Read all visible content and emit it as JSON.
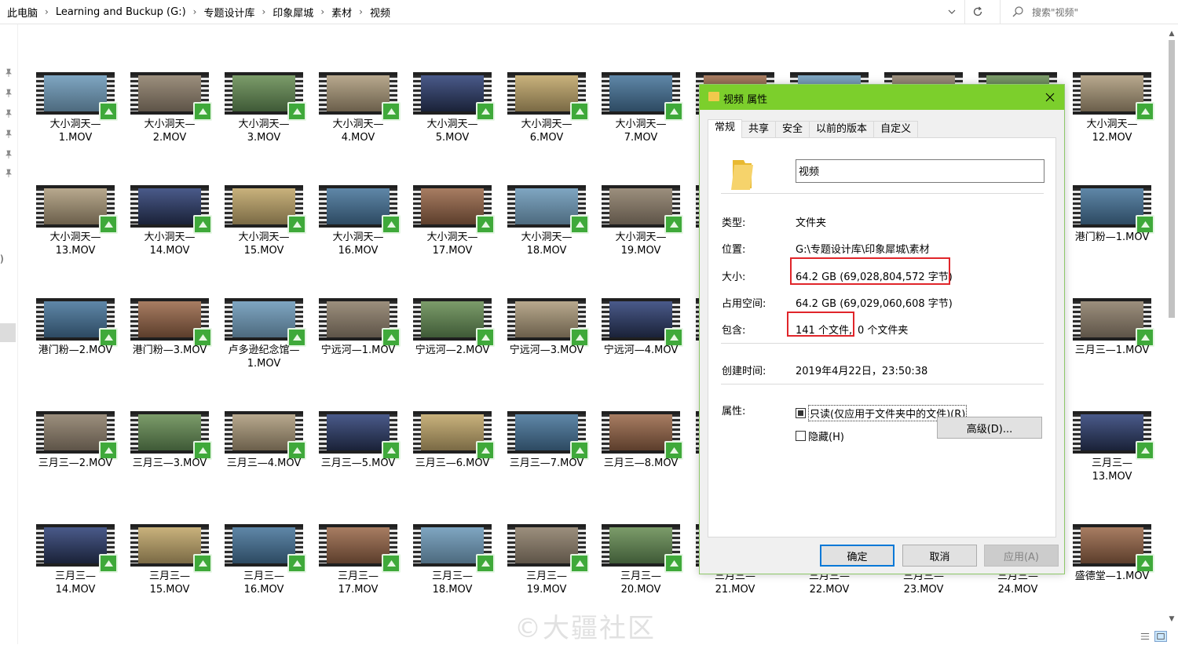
{
  "breadcrumb": {
    "items": [
      "此电脑",
      "Learning and Buckup (G:)",
      "专题设计库",
      "印象犀城",
      "素材",
      "视频"
    ]
  },
  "search": {
    "placeholder": "搜索\"视频\""
  },
  "watermark": "©大疆社区",
  "files": {
    "row1": [
      "大小洞天—\n1.MOV",
      "大小洞天—\n2.MOV",
      "大小洞天—\n3.MOV",
      "大小洞天—\n4.MOV",
      "大小洞天—\n5.MOV",
      "大小洞天—\n6.MOV",
      "大小洞天—\n7.MOV",
      "",
      "",
      "",
      "",
      "大小洞天—\n12.MOV"
    ],
    "row2": [
      "大小洞天—\n13.MOV",
      "大小洞天—\n14.MOV",
      "大小洞天—\n15.MOV",
      "大小洞天—\n16.MOV",
      "大小洞天—\n17.MOV",
      "大小洞天—\n18.MOV",
      "大小洞天—\n19.MOV",
      "",
      "",
      "",
      "",
      "港门粉—1.MOV"
    ],
    "row3": [
      "港门粉—2.MOV",
      "港门粉—3.MOV",
      "卢多逊纪念馆—\n1.MOV",
      "宁远河—1.MOV",
      "宁远河—2.MOV",
      "宁远河—3.MOV",
      "宁远河—4.MOV",
      "",
      "",
      "",
      "",
      "三月三—1.MOV"
    ],
    "row4": [
      "三月三—2.MOV",
      "三月三—3.MOV",
      "三月三—4.MOV",
      "三月三—5.MOV",
      "三月三—6.MOV",
      "三月三—7.MOV",
      "三月三—8.MOV",
      "",
      "",
      "",
      "",
      "三月三—\n13.MOV"
    ],
    "row5": [
      "三月三—\n14.MOV",
      "三月三—\n15.MOV",
      "三月三—\n16.MOV",
      "三月三—\n17.MOV",
      "三月三—\n18.MOV",
      "三月三—\n19.MOV",
      "三月三—\n20.MOV",
      "三月三—\n21.MOV",
      "三月三—\n22.MOV",
      "三月三—\n23.MOV",
      "三月三—\n24.MOV",
      "盛德堂—1.MOV"
    ]
  },
  "dialog": {
    "title": "视频 属性",
    "tabs": [
      "常规",
      "共享",
      "安全",
      "以前的版本",
      "自定义"
    ],
    "folder_name": "视频",
    "type_label": "类型:",
    "type_value": "文件夹",
    "location_label": "位置:",
    "location_value": "G:\\专题设计库\\印象犀城\\素材",
    "size_label": "大小:",
    "size_value": "64.2 GB (69,028,804,572 字节)",
    "disk_label": "占用空间:",
    "disk_value": "64.2 GB (69,029,060,608 字节)",
    "contains_label": "包含:",
    "contains_files": "141 个文件,",
    "contains_folders": "0 个文件夹",
    "created_label": "创建时间:",
    "created_value": "2019年4月22日，23:50:38",
    "attr_label": "属性:",
    "readonly_label": "只读(仅应用于文件夹中的文件)(R)",
    "hidden_label": "隐藏(H)",
    "advanced_btn": "高级(D)...",
    "ok_btn": "确定",
    "cancel_btn": "取消",
    "apply_btn": "应用(A)"
  },
  "colors": {
    "titlebar": "#7ccf2c",
    "highlight": "#e0252a",
    "badge": "#3fa93a"
  }
}
